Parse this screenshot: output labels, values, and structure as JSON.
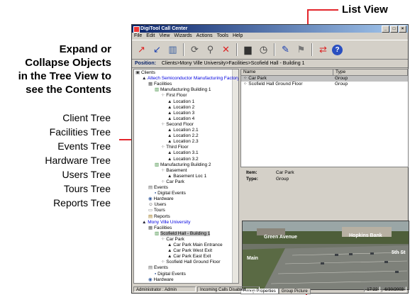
{
  "callouts": {
    "list_view": "List View",
    "expand_title": [
      "Expand or",
      "Collapse Objects",
      "in the Tree View to",
      "see the Contents"
    ],
    "trees": [
      "Client Tree",
      "Facilities Tree",
      "Events Tree",
      "Hardware Tree",
      "Users Tree",
      "Tours Tree",
      "Reports Tree"
    ]
  },
  "window": {
    "title": "DigiTool Call Center",
    "menu": [
      "File",
      "Edit",
      "View",
      "Wizards",
      "Actions",
      "Tools",
      "Help"
    ],
    "position_label": "Position:",
    "position_value": "Clients>Mony Ville University>Facilities>Scofield Hall - Building 1"
  },
  "tree": [
    {
      "text": "Clients",
      "indent": 0,
      "icon": "clients-icon"
    },
    {
      "text": "Altech Semiconductor Manufacturing Factory",
      "indent": 1,
      "icon": "client-icon",
      "blue": true
    },
    {
      "text": "Facilities",
      "indent": 2,
      "icon": "facilities-icon"
    },
    {
      "text": "Manufacturing Building 1",
      "indent": 3,
      "icon": "building-icon"
    },
    {
      "text": "First Floor",
      "indent": 4,
      "icon": "floor-icon"
    },
    {
      "text": "Location 1",
      "indent": 5,
      "icon": "location-icon"
    },
    {
      "text": "Location 2",
      "indent": 5,
      "icon": "location-icon"
    },
    {
      "text": "Location 3",
      "indent": 5,
      "icon": "location-icon"
    },
    {
      "text": "Location 4",
      "indent": 5,
      "icon": "location-icon"
    },
    {
      "text": "Second Floor",
      "indent": 4,
      "icon": "floor-icon"
    },
    {
      "text": "Location 2.1",
      "indent": 5,
      "icon": "location-icon"
    },
    {
      "text": "Location 2.2",
      "indent": 5,
      "icon": "location-icon"
    },
    {
      "text": "Location 2.3",
      "indent": 5,
      "icon": "location-icon"
    },
    {
      "text": "Third Floor",
      "indent": 4,
      "icon": "floor-icon"
    },
    {
      "text": "Location 3.1",
      "indent": 5,
      "icon": "location-icon"
    },
    {
      "text": "Location 3.2",
      "indent": 5,
      "icon": "location-icon"
    },
    {
      "text": "Manufacturing Building 2",
      "indent": 3,
      "icon": "building-icon"
    },
    {
      "text": "Basement",
      "indent": 4,
      "icon": "floor-icon"
    },
    {
      "text": "Basement Loc 1",
      "indent": 5,
      "icon": "location-icon"
    },
    {
      "text": "Car Park",
      "indent": 4,
      "icon": "floor-icon"
    },
    {
      "text": "Events",
      "indent": 2,
      "icon": "events-icon"
    },
    {
      "text": "Digital Events",
      "indent": 3,
      "icon": "event-icon"
    },
    {
      "text": "Hardware",
      "indent": 2,
      "icon": "hardware-icon"
    },
    {
      "text": "Users",
      "indent": 2,
      "icon": "users-icon"
    },
    {
      "text": "Tours",
      "indent": 2,
      "icon": "tours-icon"
    },
    {
      "text": "Reports",
      "indent": 2,
      "icon": "reports-icon"
    },
    {
      "text": "Mony Ville University",
      "indent": 1,
      "icon": "client-icon",
      "blue": true
    },
    {
      "text": "Facilities",
      "indent": 2,
      "icon": "facilities-icon"
    },
    {
      "text": "Scofield Hall - Building 1",
      "indent": 3,
      "icon": "building-icon",
      "selected": true
    },
    {
      "text": "Car Park",
      "indent": 4,
      "icon": "floor-icon"
    },
    {
      "text": "Car Park Main Entrance",
      "indent": 5,
      "icon": "location-icon"
    },
    {
      "text": "Car Park West Exit",
      "indent": 5,
      "icon": "location-icon"
    },
    {
      "text": "Car Park East Exit",
      "indent": 5,
      "icon": "location-icon"
    },
    {
      "text": "Scofield Hall Ground Floor",
      "indent": 4,
      "icon": "floor-icon"
    },
    {
      "text": "Events",
      "indent": 2,
      "icon": "events-icon"
    },
    {
      "text": "Digital Events",
      "indent": 3,
      "icon": "event-icon"
    },
    {
      "text": "Hardware",
      "indent": 2,
      "icon": "hardware-icon"
    }
  ],
  "list": {
    "columns": [
      "Name",
      "Type"
    ],
    "rows": [
      {
        "name": "Car Park",
        "type": "Group",
        "selected": true
      },
      {
        "name": "Scofield Hall Ground Floor",
        "type": "Group"
      }
    ]
  },
  "info": {
    "item_label": "Item:",
    "item_value": "Car Park",
    "type_label": "Type:",
    "type_value": "Group"
  },
  "picture_labels": [
    "Green Avenue",
    "Hopkins Bank",
    "Main",
    "5th St"
  ],
  "tabs": [
    "Group Properties",
    "Group Picture"
  ],
  "status": {
    "user": "Administrator : Admin",
    "calls": "Incoming Calls Disabled",
    "time": "17:22",
    "date": "6/30/2003"
  }
}
